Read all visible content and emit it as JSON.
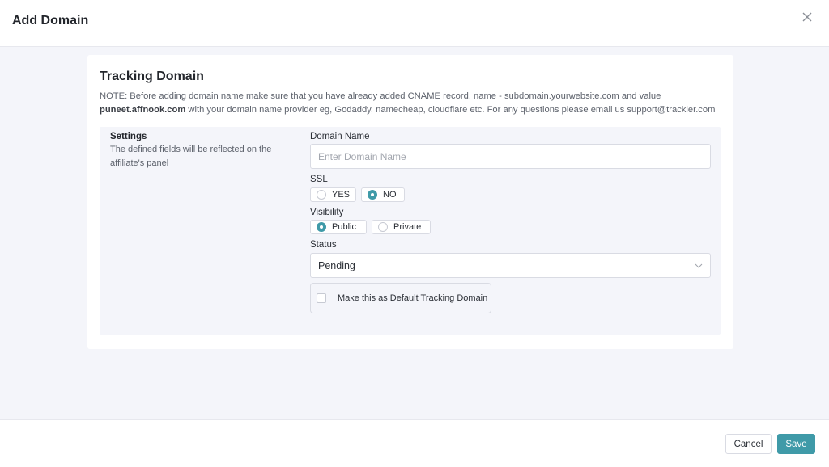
{
  "modal": {
    "title": "Add Domain"
  },
  "section": {
    "title": "Tracking Domain",
    "note_part1": "NOTE: Before adding domain name make sure that you have already added CNAME record, name - subdomain.yourwebsite.com and value",
    "note_bold": "puneet.affnook.com",
    "note_part2": " with your domain name provider eg, Godaddy, namecheap, cloudflare etc. For any questions please email us support@trackier.com"
  },
  "settings": {
    "title": "Settings",
    "description": "The defined fields will be reflected on the affiliate's panel",
    "domain_name": {
      "label": "Domain Name",
      "placeholder": "Enter Domain Name",
      "value": ""
    },
    "ssl": {
      "label": "SSL",
      "options": [
        "YES",
        "NO"
      ],
      "selected": "NO"
    },
    "visibility": {
      "label": "Visibility",
      "options": [
        "Public",
        "Private"
      ],
      "selected": "Public"
    },
    "status": {
      "label": "Status",
      "value": "Pending"
    },
    "default_checkbox": {
      "label": "Make this as Default Tracking Domain",
      "checked": false
    }
  },
  "footer": {
    "cancel_label": "Cancel",
    "save_label": "Save"
  },
  "colors": {
    "accent": "#3f9aa8",
    "panel_bg": "#f4f5fa"
  },
  "icons": {
    "close": "close-icon",
    "chevron": "chevron-down-icon"
  }
}
